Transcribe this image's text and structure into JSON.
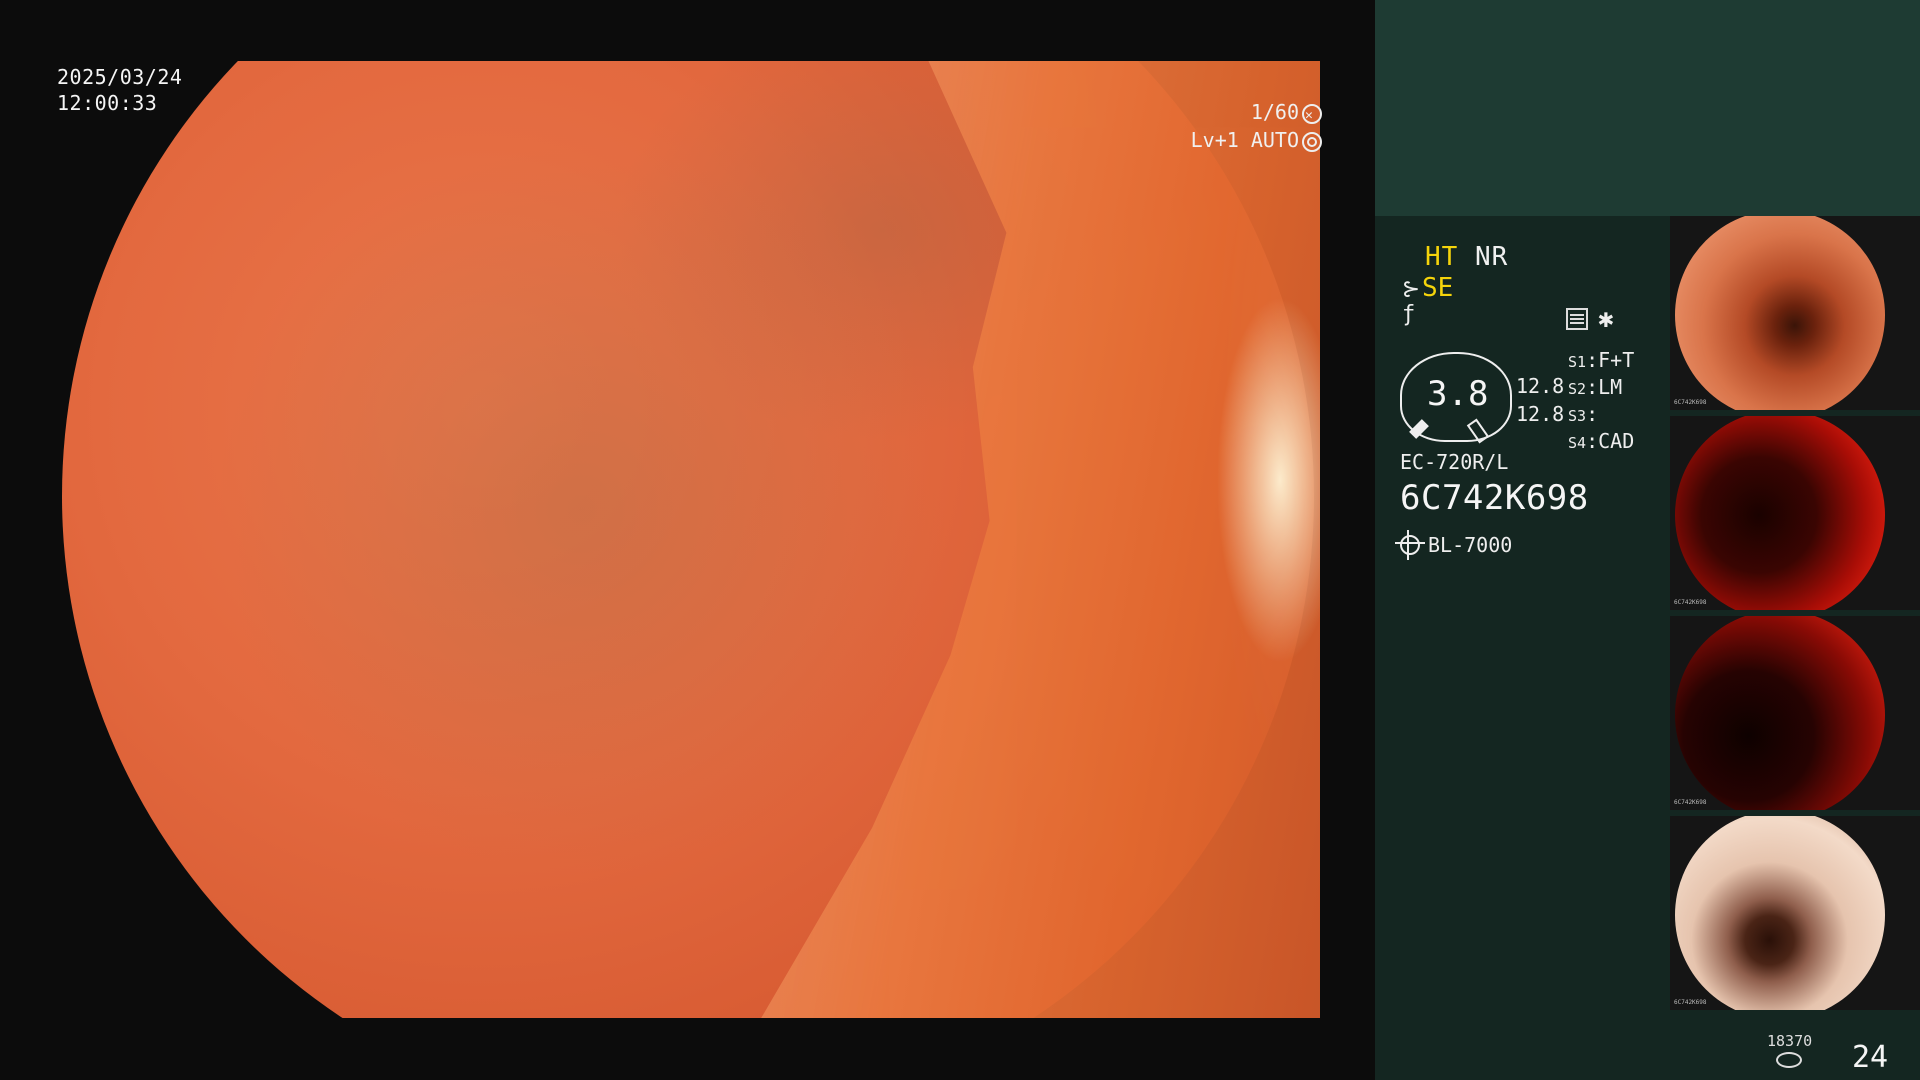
{
  "osd": {
    "date": "2025/03/24",
    "time": "12:00:33",
    "shutter": "1/60",
    "level": "Lv+1",
    "iris": "AUTO"
  },
  "panel": {
    "mode_ht": "HT",
    "mode_nr": "NR",
    "mode_se": "SE",
    "dial_value": "3.8",
    "num_top": "12.8",
    "num_bottom": "12.8",
    "s1_label": "S1",
    "s1_value": "F+T",
    "s2_label": "S2",
    "s2_value": "LM",
    "s3_label": "S3",
    "s3_value": "",
    "s4_label": "S4",
    "s4_value": "CAD",
    "scope_model": "EC-720R/L",
    "serial": "6C742K698",
    "light_source": "BL-7000",
    "capture_small": "18370",
    "capture_count": "24"
  },
  "thumbnails": [
    {
      "serial": "6C742K698"
    },
    {
      "serial": "6C742K698"
    },
    {
      "serial": "6C742K698"
    },
    {
      "serial": "6C742K698"
    }
  ],
  "colors": {
    "accent_yellow": "#f5d40b",
    "panel_top": "#1e3b33",
    "panel": "#142621"
  }
}
